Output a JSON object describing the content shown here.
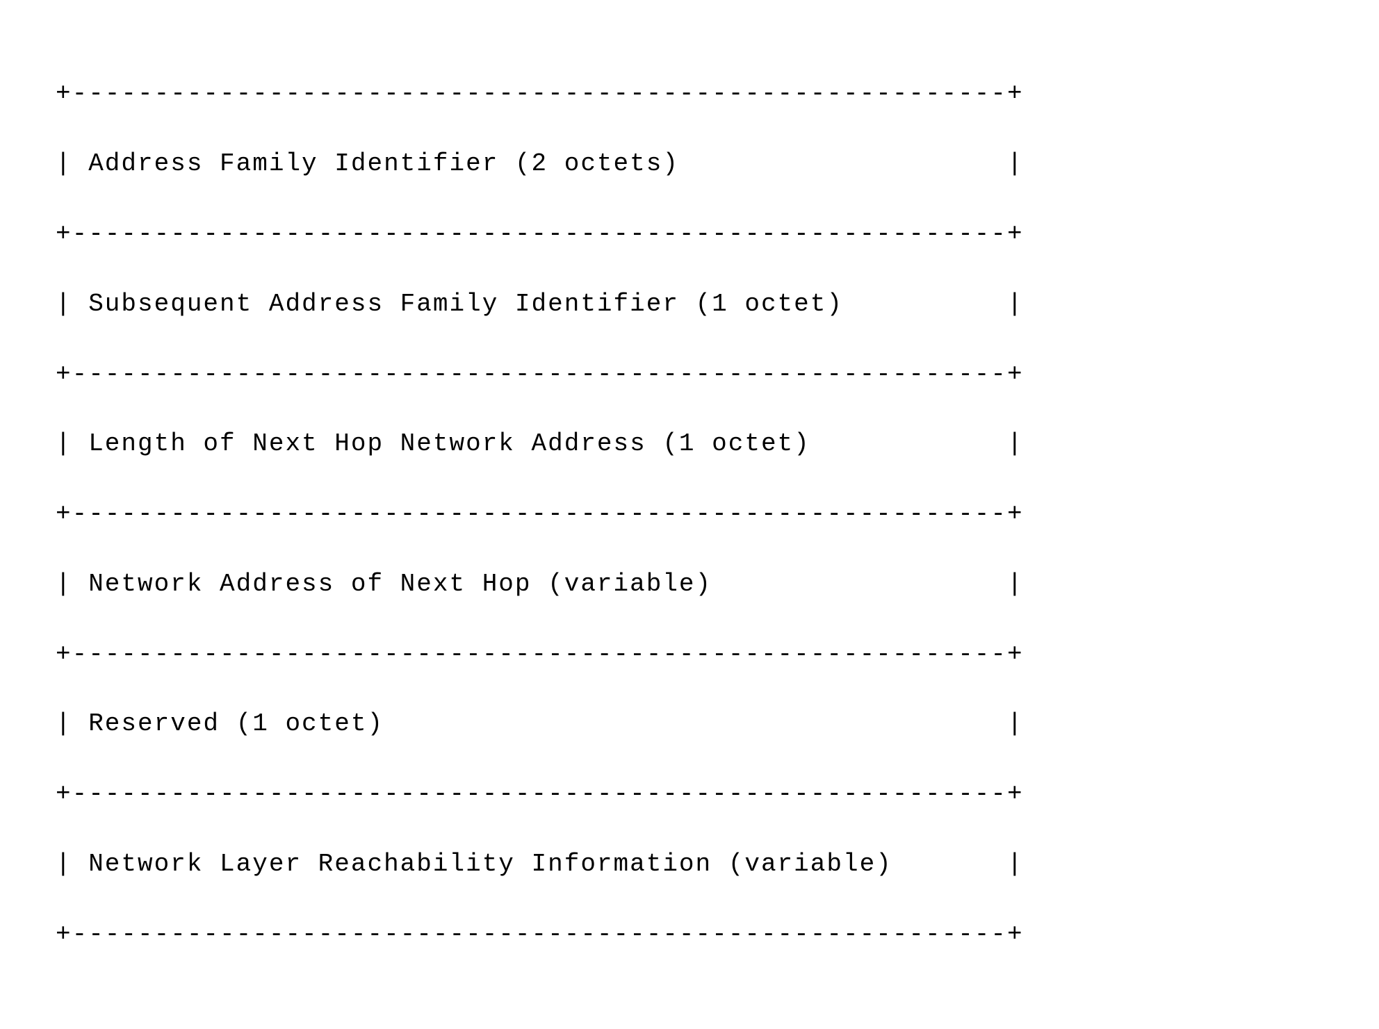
{
  "diagram": {
    "fields": [
      {
        "name": "Address Family Identifier",
        "size": "2 octets"
      },
      {
        "name": "Subsequent Address Family Identifier",
        "size": "1 octet"
      },
      {
        "name": "Length of Next Hop Network Address",
        "size": "1 octet"
      },
      {
        "name": "Network Address of Next Hop",
        "size": "variable"
      },
      {
        "name": "Reserved",
        "size": "1 octet"
      },
      {
        "name": "Network Layer Reachability Information",
        "size": "variable"
      }
    ],
    "width_chars": 57,
    "lines": {
      "border": "+---------------------------------------------------------+",
      "row0": "| Address Family Identifier (2 octets)                    |",
      "row1": "| Subsequent Address Family Identifier (1 octet)          |",
      "row2": "| Length of Next Hop Network Address (1 octet)            |",
      "row3": "| Network Address of Next Hop (variable)                  |",
      "row4": "| Reserved (1 octet)                                      |",
      "row5": "| Network Layer Reachability Information (variable)       |"
    }
  }
}
